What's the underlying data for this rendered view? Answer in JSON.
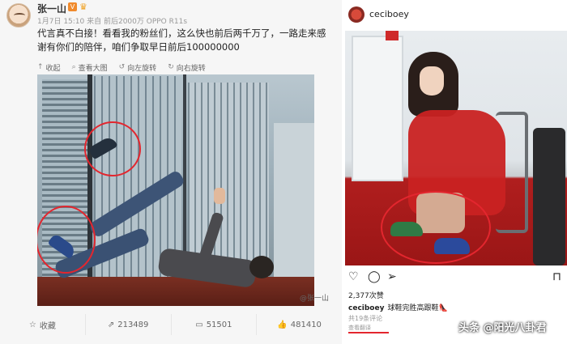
{
  "weibo": {
    "author": "张一山",
    "meta": "1月7日 15:10 来自 前后2000万 OPPO R11s",
    "post_text": "代言真不白接！看看我的粉丝们，这么快也前后两千万了，一路走来感谢有你们的陪伴，咱们争取早日前后100000000",
    "toolbar": [
      {
        "icon": "collapse-icon",
        "label": "收起"
      },
      {
        "icon": "zoom-icon",
        "label": "查看大图"
      },
      {
        "icon": "rotate-left-icon",
        "label": "向左旋转"
      },
      {
        "icon": "rotate-right-icon",
        "label": "向右旋转"
      }
    ],
    "watermark": "@张一山",
    "actions": [
      {
        "icon": "star-icon",
        "label": "收藏"
      },
      {
        "icon": "share-icon",
        "label": "213489"
      },
      {
        "icon": "comment-icon",
        "label": "51501"
      },
      {
        "icon": "like-icon",
        "label": "481410"
      }
    ]
  },
  "instagram": {
    "username": "ceciboey",
    "likes": "2,377次赞",
    "caption_user": "ceciboey",
    "caption_text": "球鞋完胜高跟鞋👠",
    "comments": "共19条评论",
    "translate": "查看翻译",
    "icons": [
      "heart-icon",
      "comment-icon",
      "send-icon",
      "bookmark-icon"
    ]
  },
  "source_mark": "头条 @阳光八卦君",
  "colors": {
    "annotation_red": "#e3262e",
    "weibo_bg": "#f6f6f6",
    "vip_orange": "#f08a2c"
  }
}
